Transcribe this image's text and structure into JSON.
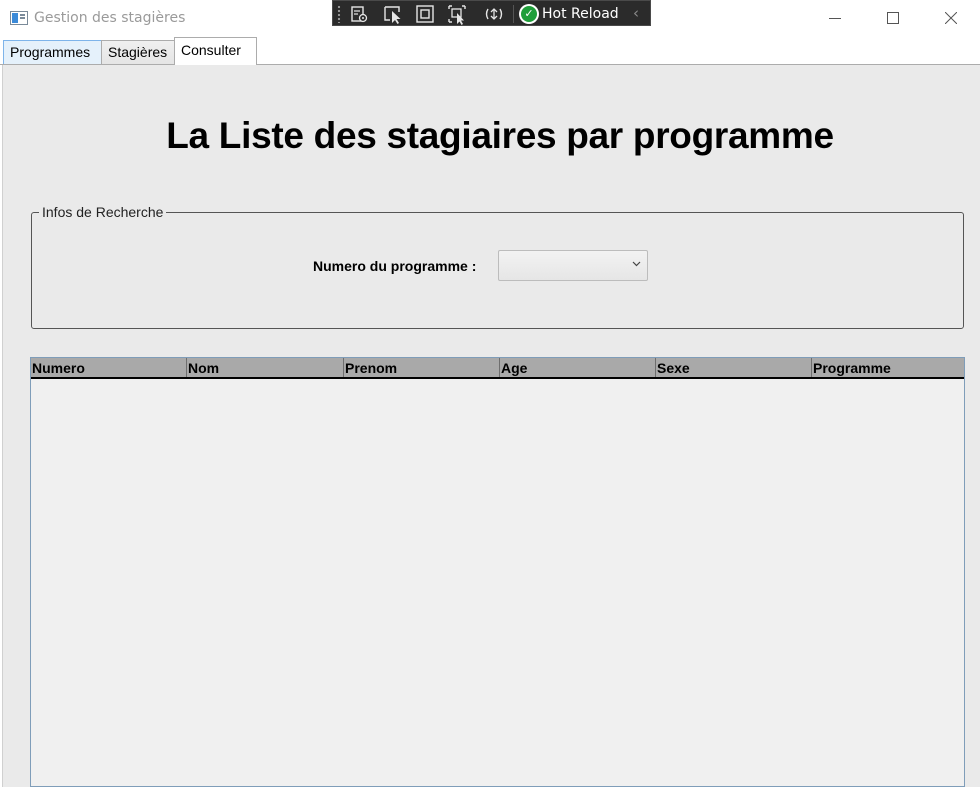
{
  "window": {
    "title": "Gestion des stagières",
    "icon": "app-window-icon",
    "controls": [
      "minimize-icon",
      "maximize-icon",
      "close-icon"
    ]
  },
  "devtools": {
    "icons": [
      "live-visual-tree-icon",
      "select-element-icon",
      "display-layout-adorners-icon",
      "track-focus-icon",
      "binding-failures-icon"
    ],
    "hot_reload_label": "Hot Reload",
    "hot_reload_status_icon": "checkmark-icon",
    "collapse_icon": "chevron-left-icon"
  },
  "tabs": [
    {
      "label": "Programmes",
      "active": false
    },
    {
      "label": "Stagières",
      "active": false
    },
    {
      "label": "Consulter",
      "active": true
    }
  ],
  "page": {
    "title": "La Liste des stagiaires par programme"
  },
  "search": {
    "group_title": "Infos de Recherche",
    "program_label": "Numero du programme :",
    "program_value": ""
  },
  "grid": {
    "columns": [
      "Numero",
      "Nom",
      "Prenom",
      "Age",
      "Sexe",
      "Programme"
    ],
    "rows": []
  },
  "colors": {
    "content_bg": "#eaeaea",
    "grid_header_bg": "#a9a9a9",
    "devbar_bg": "#2b2b2b",
    "hot_reload_green": "#1f9e3a",
    "tab_hover_bg": "#e5f1fb"
  }
}
